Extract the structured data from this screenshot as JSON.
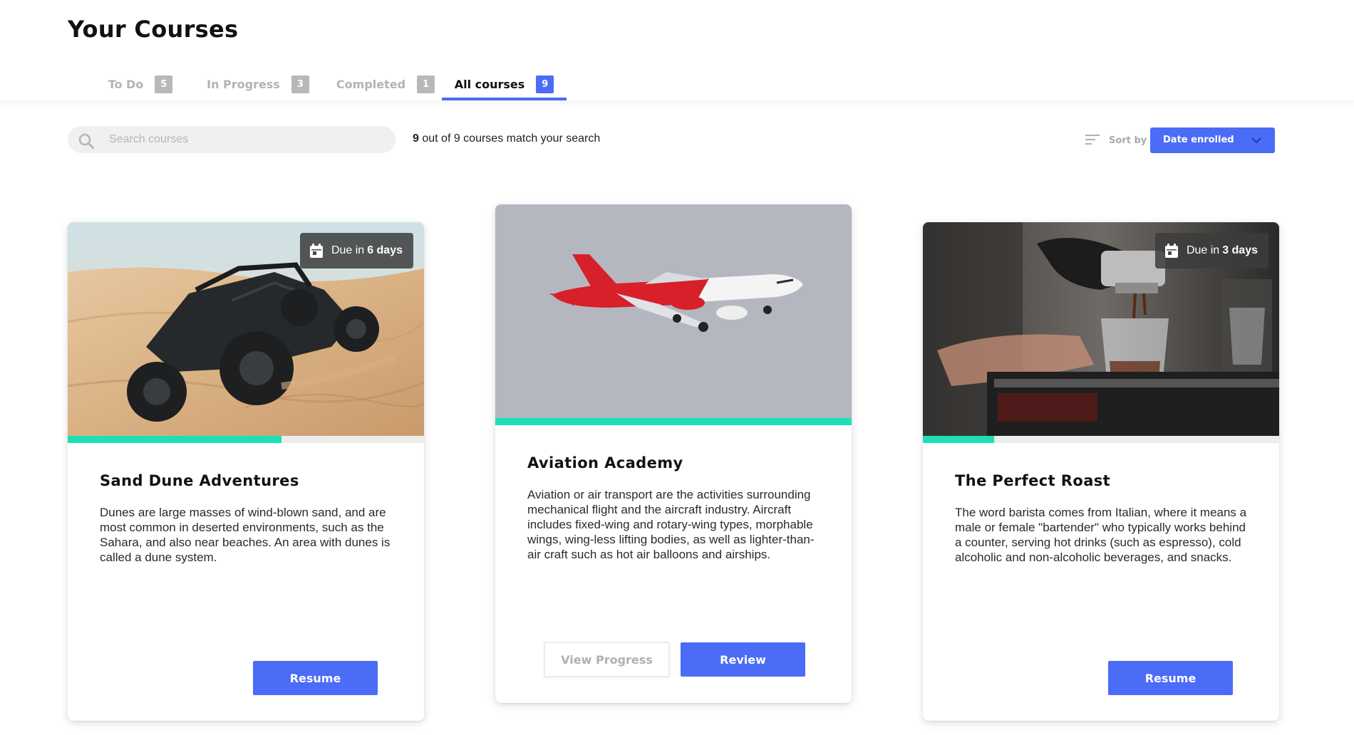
{
  "page": {
    "title": "Your Courses"
  },
  "tabs": [
    {
      "label": "To Do",
      "count": "5",
      "active": false
    },
    {
      "label": "In Progress",
      "count": "3",
      "active": false
    },
    {
      "label": "Completed",
      "count": "1",
      "active": false
    },
    {
      "label": "All courses",
      "count": "9",
      "active": true
    }
  ],
  "search": {
    "placeholder": "Search courses",
    "value": "",
    "match_count": "9",
    "match_text": " out of 9 courses match your search"
  },
  "sort": {
    "label": "Sort by",
    "value": "Date enrolled"
  },
  "colors": {
    "accent": "#4a6cf7",
    "progress": "#1de0b4"
  },
  "courses": [
    {
      "title": "Sand Dune Adventures",
      "description": "Dunes are large masses of wind-blown sand, and are most common in deserted environments, such as the Sahara, and also near beaches. An area with dunes is called a dune system.",
      "image": "desert-buggy",
      "progress_percent": 60,
      "due_prefix": "Due in",
      "due_value": "6 days",
      "primary_button": "Resume"
    },
    {
      "title": "Aviation Academy",
      "description": "Aviation or air transport are the activities surrounding mechanical flight and the aircraft industry. Aircraft includes fixed-wing and rotary-wing types, morphable wings, wing-less lifting bodies, as well as lighter-than-air craft such as hot air balloons and airships.",
      "image": "airplane",
      "progress_percent": 100,
      "secondary_button": "View Progress",
      "primary_button": "Review"
    },
    {
      "title": "The Perfect Roast",
      "description": "The word barista comes from Italian, where it means a male or female \"bartender\" who typically works behind a counter, serving hot drinks (such as espresso), cold alcoholic and non-alcoholic beverages, and snacks.",
      "image": "espresso-machine",
      "progress_percent": 20,
      "due_prefix": "Due in",
      "due_value": "3 days",
      "primary_button": "Resume"
    }
  ]
}
